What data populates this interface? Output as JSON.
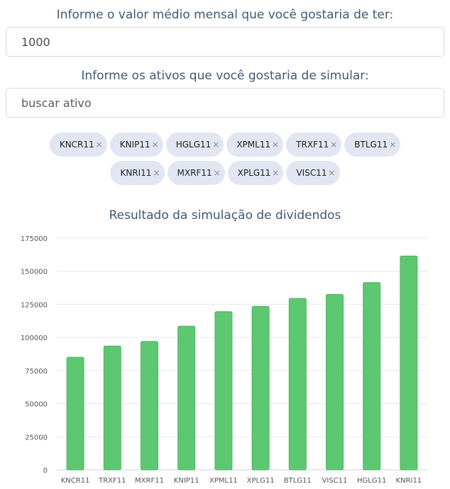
{
  "form": {
    "monthly_label": "Informe o valor médio mensal que você gostaria de ter:",
    "monthly_value": "1000",
    "assets_label": "Informe os ativos que você gostaria de simular:",
    "search_placeholder": "buscar ativo"
  },
  "tags": [
    {
      "label": "KNCR11",
      "remove": "×"
    },
    {
      "label": "KNIP11",
      "remove": "×"
    },
    {
      "label": "HGLG11",
      "remove": "×"
    },
    {
      "label": "XPML11",
      "remove": "×"
    },
    {
      "label": "TRXF11",
      "remove": "×"
    },
    {
      "label": "BTLG11",
      "remove": "×"
    },
    {
      "label": "KNRI11",
      "remove": "×"
    },
    {
      "label": "MXRF11",
      "remove": "×"
    },
    {
      "label": "XPLG11",
      "remove": "×"
    },
    {
      "label": "VISC11",
      "remove": "×"
    }
  ],
  "chart_data": {
    "type": "bar",
    "title": "Resultado da simulação de dividendos",
    "categories": [
      "KNCR11",
      "TRXF11",
      "MXRF11",
      "KNIP11",
      "XPML11",
      "XPLG11",
      "BTLG11",
      "VISC11",
      "HGLG11",
      "KNRI11"
    ],
    "values": [
      85000,
      93500,
      97000,
      108500,
      119500,
      123500,
      129500,
      132500,
      141500,
      161500
    ],
    "ylim": [
      0,
      175000
    ],
    "yticks": [
      0,
      25000,
      50000,
      75000,
      100000,
      125000,
      150000,
      175000
    ],
    "grid": true,
    "bar_color": "#5ec772",
    "bar_border": "#4fb463",
    "xlabel": "",
    "ylabel": ""
  },
  "colors": {
    "label_text": "#3d5a73",
    "tag_background": "#e1e6f2"
  }
}
